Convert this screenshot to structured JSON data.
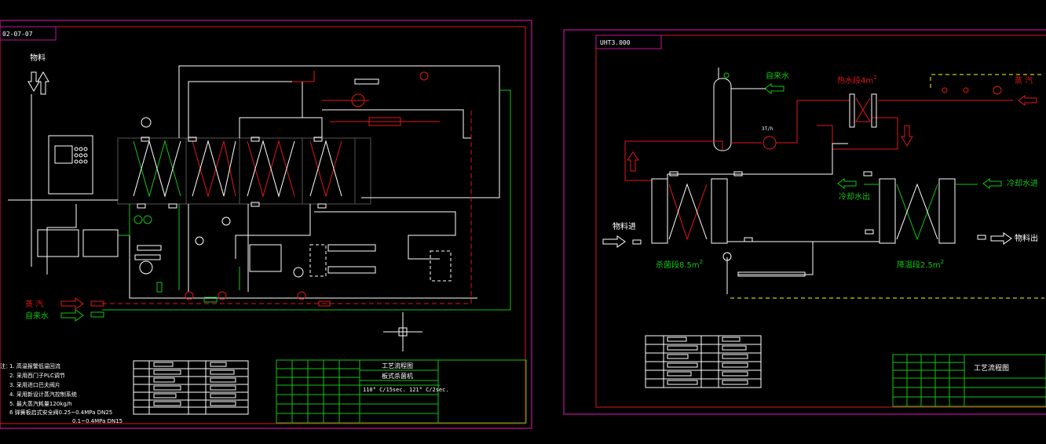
{
  "colors": {
    "background": "#000000",
    "frame": "#c0139e",
    "border": "#e01818",
    "pipe_steam": "#e01818",
    "pipe_water": "#13c513",
    "line_main": "#ffffff",
    "dashed": "#ffff00"
  },
  "left_drawing": {
    "tag": "02-07-07",
    "label_material": "物料",
    "label_steam": "蒸 汽",
    "label_tap_water": "自来水",
    "notes_prefix": "注：",
    "notes": [
      "1. 高温报警低温回流",
      "2. 采用西门子PLC调节",
      "3. 采用进口巴夫阀片",
      "4. 采用新设计蒸汽控制系统",
      "5. 最大蒸汽耗量120kg/h",
      "6 弹簧板启式安全阀0.25~0.4MPa DN25"
    ],
    "notes_cont": "0.1~0.4MPa DN15",
    "title_block": {
      "title1": "工艺流程图",
      "title2": "板式杀菌机",
      "spec": "110° C/15sec.  121° C/2sec."
    }
  },
  "right_drawing": {
    "tag": "UHT3.000",
    "label_tap_water": "自来水",
    "label_hot_water": "热水段4m",
    "hot_water_sup": "2",
    "label_steam": "蒸 汽",
    "label_pump_spec": "3T/h",
    "label_cooling_in": "冷却水进",
    "label_cooling_out": "冷却水出",
    "label_material_in": "物料进",
    "label_material_out": "物料出",
    "label_sterilize": "杀菌段8.5m",
    "sterilize_sup": "2",
    "label_cool_down": "降温段2.5m",
    "cool_down_sup": "2",
    "title_block": {
      "title1": "工艺流程图"
    }
  }
}
